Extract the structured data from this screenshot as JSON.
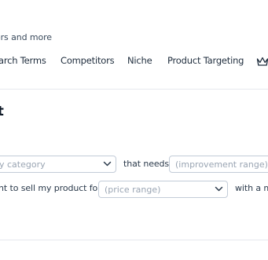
{
  "header": {
    "subtitle_fragment": "ors and more"
  },
  "nav": {
    "items": [
      {
        "label": "arch Terms"
      },
      {
        "label": "Competitors"
      },
      {
        "label": "Niche"
      },
      {
        "label": "Product Targeting"
      }
    ],
    "trailing_icon": "crown-icon"
  },
  "page": {
    "title_fragment": "ct"
  },
  "form": {
    "category_select": {
      "placeholder": "y category"
    },
    "that_needs_text": "that needs",
    "improvement_select": {
      "placeholder": "(improvement range)"
    },
    "sell_text": "nt to sell my product for",
    "price_select": {
      "placeholder": "(price range)"
    },
    "with_text": "with a m"
  }
}
